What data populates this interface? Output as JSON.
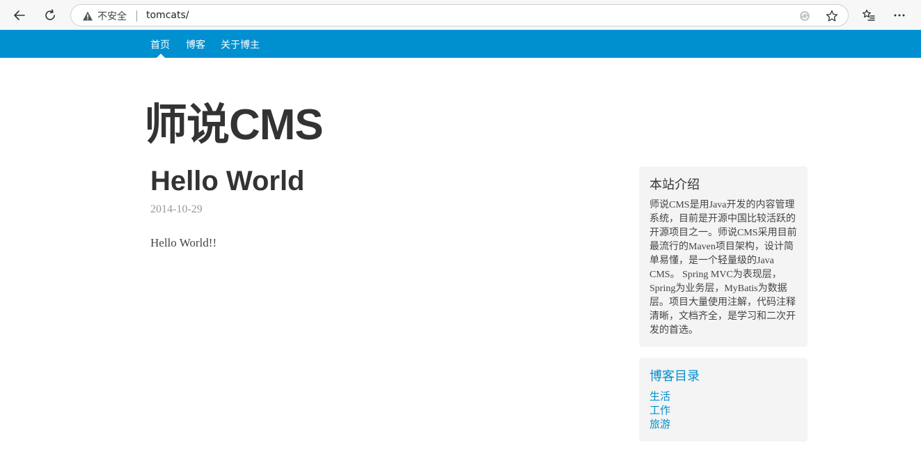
{
  "browser": {
    "security_label": "不安全",
    "url": "tomcats/"
  },
  "nav": {
    "items": [
      {
        "label": "首页"
      },
      {
        "label": "博客"
      },
      {
        "label": "关于博主"
      }
    ],
    "active_index": 0,
    "accent_color": "#0090d0"
  },
  "site": {
    "title": "师说CMS"
  },
  "post": {
    "title": "Hello World",
    "date": "2014-10-29",
    "body": "Hello World!!"
  },
  "sidebar": {
    "intro": {
      "title": "本站介绍",
      "text": "师说CMS是用Java开发的内容管理系统，目前是开源中国比较活跃的开源项目之一。师说CMS采用目前最流行的Maven项目架构，设计简单易懂，是一个轻量级的Java CMS。 Spring MVC为表现层，Spring为业务层，MyBatis为数据层。项目大量使用注解，代码注释清晰，文档齐全，是学习和二次开发的首选。"
    },
    "categories": {
      "title": "博客目录",
      "items": [
        "生活",
        "工作",
        "旅游"
      ]
    }
  },
  "icons": {
    "back": "back-arrow-icon",
    "refresh": "refresh-icon",
    "warning": "warning-icon",
    "favorite": "star-icon",
    "favorites": "favorites-list-icon",
    "menu": "more-icon"
  }
}
